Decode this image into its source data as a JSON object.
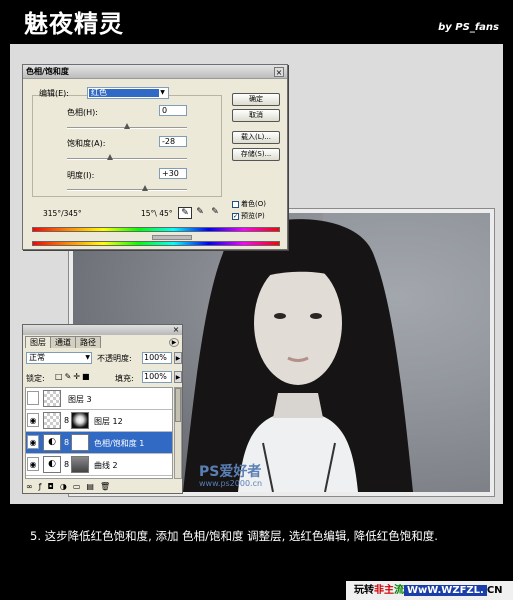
{
  "header": {
    "title": "魅夜精灵",
    "byline": "by PS_fans"
  },
  "hue_sat_dialog": {
    "title": "色相/饱和度",
    "edit_label": "编辑(E):",
    "edit_value": "红色",
    "hue_label": "色相(H):",
    "hue_value": "0",
    "saturation_label": "饱和度(A):",
    "saturation_value": "-28",
    "lightness_label": "明度(I):",
    "lightness_value": "+30",
    "ok_label": "确定",
    "cancel_label": "取消",
    "load_label": "载入(L)...",
    "save_label": "存储(S)...",
    "colorize_label": "着色(O)",
    "colorize_checked": false,
    "preview_label": "预览(P)",
    "preview_checked": true,
    "range_left": "315°/345°",
    "range_right": "15°\\ 45°"
  },
  "layers_panel": {
    "tabs": [
      "图层",
      "通道",
      "路径"
    ],
    "active_tab": "图层",
    "blend_mode": "正常",
    "opacity_label": "不透明度:",
    "opacity_value": "100%",
    "lock_label": "锁定:",
    "fill_label": "填充:",
    "fill_value": "100%",
    "layers": [
      {
        "name": "图层 3",
        "visible": false,
        "selected": false
      },
      {
        "name": "图层 12",
        "visible": true,
        "selected": false
      },
      {
        "name": "色相/饱和度 1",
        "visible": true,
        "selected": true
      },
      {
        "name": "曲线 2",
        "visible": true,
        "selected": false
      }
    ]
  },
  "watermark": {
    "main": "PS爱好者",
    "url": "www.ps2000.cn"
  },
  "caption": "5. 这步降低红色饱和度, 添加 色相/饱和度 调整层, 选红色编辑, 降低红色饱和度.",
  "footer_brand": {
    "p1": "玩转",
    "p2": "非主",
    "p3": "流",
    "p4": "WwW.WZFZL.",
    "p5": "CN"
  },
  "colors": {
    "selection": "#316ac5",
    "dialog_bg": "#ece9d8",
    "page_bg": "#000000"
  }
}
